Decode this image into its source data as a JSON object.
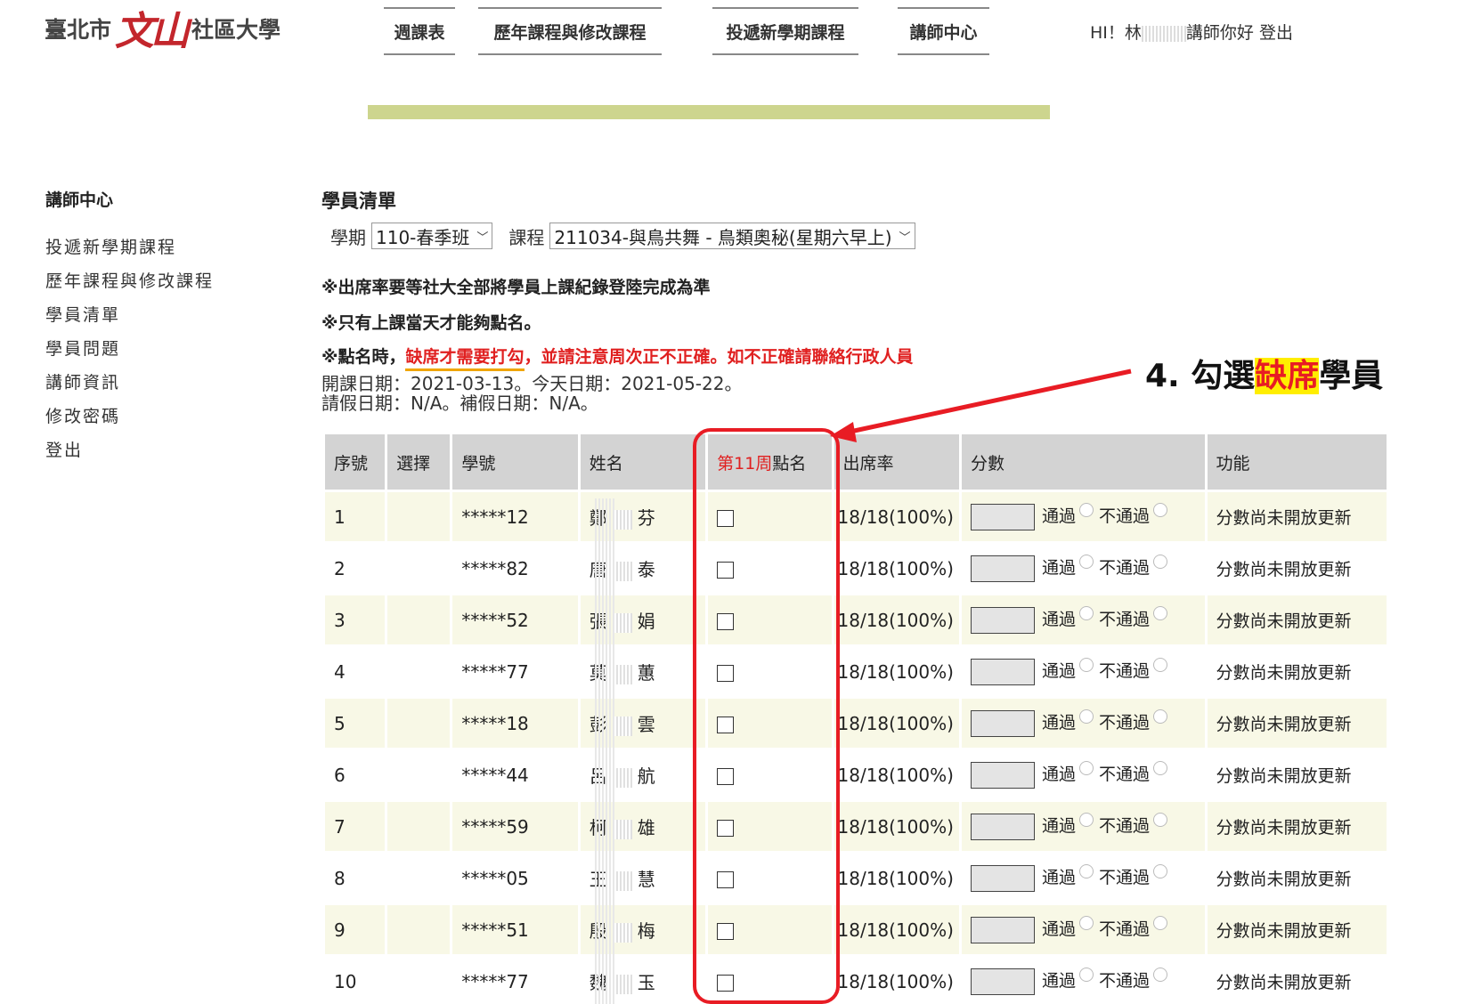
{
  "logo": {
    "left_text": "臺北市",
    "mark_text": "文山",
    "right_text": "社區大學"
  },
  "topnav": [
    {
      "label": "週課表"
    },
    {
      "label": "歷年課程與修改課程"
    },
    {
      "label": "投遞新學期課程"
    },
    {
      "label": "講師中心"
    }
  ],
  "greeting": {
    "prefix": "HI！林",
    "suffix": "講師你好",
    "logout": "登出"
  },
  "sidebar": {
    "title": "講師中心",
    "items": [
      {
        "label": "投遞新學期課程"
      },
      {
        "label": "歷年課程與修改課程"
      },
      {
        "label": "學員清單"
      },
      {
        "label": "學員問題"
      },
      {
        "label": "講師資訊"
      },
      {
        "label": "修改密碼"
      },
      {
        "label": "登出"
      }
    ]
  },
  "main": {
    "title": "學員清單",
    "semester_label": "學期",
    "semester_value": "110-春季班",
    "course_label": "課程",
    "course_value": "211034-與鳥共舞 - 鳥類奧秘(星期六早上)",
    "note1": "※出席率要等社大全部將學員上課紀錄登陸完成為準",
    "note2": "※只有上課當天才能夠點名。",
    "note3_prefix": "※點名時，",
    "note3_underlined": "缺席才需要打勾",
    "note3_rest": "，並請注意周次正不正確。如不正確請聯絡行政人員",
    "dates_line1": "開課日期：2021-03-13。今天日期：2021-05-22。",
    "dates_line2": "請假日期：N/A。補假日期：N/A。"
  },
  "table": {
    "headers": {
      "seq": "序號",
      "select": "選擇",
      "student_id": "學號",
      "name": "姓名",
      "rollcall_week": "第11周",
      "rollcall_suffix": "點名",
      "attendance": "出席率",
      "score": "分數",
      "function": "功能"
    },
    "pass_label": "通過",
    "fail_label": "不通過",
    "rows": [
      {
        "seq": "1",
        "student_id": "*****12",
        "name_first": "鄭",
        "name_last": "芬",
        "attendance": "18/18(100%)",
        "function": "分數尚未開放更新"
      },
      {
        "seq": "2",
        "student_id": "*****82",
        "name_first": "唐",
        "name_last": "泰",
        "attendance": "18/18(100%)",
        "function": "分數尚未開放更新"
      },
      {
        "seq": "3",
        "student_id": "*****52",
        "name_first": "張",
        "name_last": "娟",
        "attendance": "18/18(100%)",
        "function": "分數尚未開放更新"
      },
      {
        "seq": "4",
        "student_id": "*****77",
        "name_first": "莫",
        "name_last": "蕙",
        "attendance": "18/18(100%)",
        "function": "分數尚未開放更新"
      },
      {
        "seq": "5",
        "student_id": "*****18",
        "name_first": "彭",
        "name_last": "雲",
        "attendance": "18/18(100%)",
        "function": "分數尚未開放更新"
      },
      {
        "seq": "6",
        "student_id": "*****44",
        "name_first": "呂",
        "name_last": "航",
        "attendance": "18/18(100%)",
        "function": "分數尚未開放更新"
      },
      {
        "seq": "7",
        "student_id": "*****59",
        "name_first": "柯",
        "name_last": "雄",
        "attendance": "18/18(100%)",
        "function": "分數尚未開放更新"
      },
      {
        "seq": "8",
        "student_id": "*****05",
        "name_first": "王",
        "name_last": "慧",
        "attendance": "18/18(100%)",
        "function": "分數尚未開放更新"
      },
      {
        "seq": "9",
        "student_id": "*****51",
        "name_first": "殷",
        "name_last": "梅",
        "attendance": "18/18(100%)",
        "function": "分數尚未開放更新"
      },
      {
        "seq": "10",
        "student_id": "*****77",
        "name_first": "魏",
        "name_last": "玉",
        "attendance": "18/18(100%)",
        "function": "分數尚未開放更新"
      }
    ]
  },
  "annotation": {
    "prefix": "4. 勾選",
    "highlight": "缺席",
    "suffix": "學員"
  },
  "colors": {
    "highlight_red": "#e81c24",
    "green_bar": "#cdd58e",
    "header_gray": "#d3d3d3",
    "row_tint": "#f8f8e6",
    "marker_yellow": "#ffee00"
  }
}
